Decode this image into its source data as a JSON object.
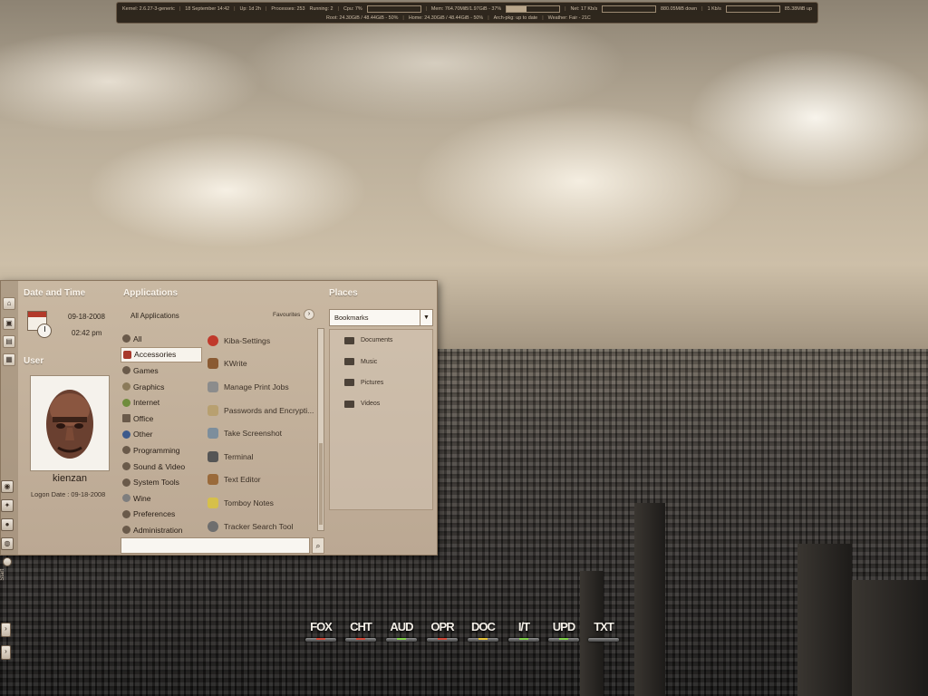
{
  "statusbar": {
    "kernel": "Kernel: 2.6.27-3-generic",
    "date": "18 September 14:42",
    "uptime": "Up: 1d 2h",
    "processes": "Processes: 253",
    "running": "Running: 2",
    "cpu": "Cpu: 7%",
    "mem": "Mem: 764.70MiB/1.97GiB - 37%",
    "net": "Net: 17 Kb/s",
    "down": "880.05MiB down",
    "up_rate": "1 Kb/s",
    "up_total": "85.38MiB up",
    "root": "Root: 24.30GiB / 48.44GiB - 50%",
    "home": "Home: 24.30GiB / 48.44GiB - 50%",
    "archpkg": "Arch-pkg: up to date",
    "weather": "Weather: Fair - 21C"
  },
  "menu": {
    "datetime_title": "Date and Time",
    "date": "09-18-2008",
    "time": "02:42 pm",
    "user_title": "User",
    "username": "kienzan",
    "logon": "Logon Date : 09-18-2008",
    "applications_title": "Applications",
    "all_applications": "All Applications",
    "favourites": "Favourites",
    "categories": [
      {
        "label": "All",
        "active": false
      },
      {
        "label": "Accessories",
        "active": true
      },
      {
        "label": "Games",
        "active": false
      },
      {
        "label": "Graphics",
        "active": false
      },
      {
        "label": "Internet",
        "active": false
      },
      {
        "label": "Office",
        "active": false
      },
      {
        "label": "Other",
        "active": false
      },
      {
        "label": "Programming",
        "active": false
      },
      {
        "label": "Sound & Video",
        "active": false
      },
      {
        "label": "System Tools",
        "active": false
      },
      {
        "label": "Wine",
        "active": false
      },
      {
        "label": "Preferences",
        "active": false
      },
      {
        "label": "Administration",
        "active": false
      }
    ],
    "apps": [
      {
        "label": "Kiba-Settings",
        "color": "#c0392b"
      },
      {
        "label": "KWrite",
        "color": "#8a5a32"
      },
      {
        "label": "Manage Print Jobs",
        "color": "#8c8c8c"
      },
      {
        "label": "Passwords and Encrypti...",
        "color": "#b8a070"
      },
      {
        "label": "Take Screenshot",
        "color": "#7d8e9c"
      },
      {
        "label": "Terminal",
        "color": "#555555"
      },
      {
        "label": "Text Editor",
        "color": "#9a6a3a"
      },
      {
        "label": "Tomboy Notes",
        "color": "#d6c04a"
      },
      {
        "label": "Tracker Search Tool",
        "color": "#6e6e6e"
      }
    ],
    "places_title": "Places",
    "places_selected": "Bookmarks",
    "places": [
      "Documents",
      "Music",
      "Pictures",
      "Videos"
    ]
  },
  "leftdock": {
    "start_label": "Start"
  },
  "dock": [
    {
      "label": "FOX",
      "status": "red"
    },
    {
      "label": "CHT",
      "status": "red"
    },
    {
      "label": "AUD",
      "status": "green"
    },
    {
      "label": "OPR",
      "status": "red"
    },
    {
      "label": "DOC",
      "status": "yellow"
    },
    {
      "label": "I/T",
      "status": "green"
    },
    {
      "label": "UPD",
      "status": "green"
    },
    {
      "label": "TXT",
      "status": "none"
    }
  ],
  "colors": {
    "menu_bg": "#c4b39d",
    "accent_text": "#fbf5ec",
    "statusbar_bg": "#261e16"
  }
}
